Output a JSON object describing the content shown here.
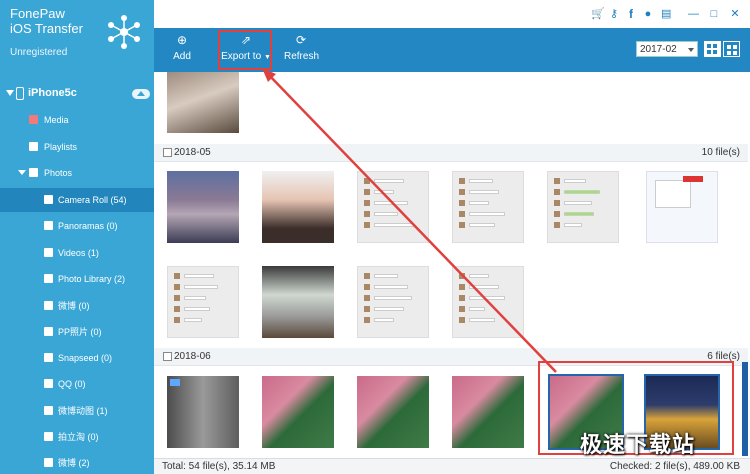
{
  "app": {
    "name_line1": "FonePaw",
    "name_line2": "iOS Transfer",
    "registration": "Unregistered"
  },
  "device": {
    "name": "iPhone5c"
  },
  "sidebar": {
    "items": [
      {
        "label": "Media",
        "icon": "music-icon"
      },
      {
        "label": "Playlists",
        "icon": "playlist-icon"
      },
      {
        "label": "Photos",
        "icon": "photos-icon"
      },
      {
        "label": "Camera Roll (54)",
        "icon": "camera-icon"
      },
      {
        "label": "Panoramas (0)",
        "icon": "camera-icon"
      },
      {
        "label": "Videos (1)",
        "icon": "camera-icon"
      },
      {
        "label": "Photo Library (2)",
        "icon": "album-icon"
      },
      {
        "label": "微博 (0)",
        "icon": "album-icon"
      },
      {
        "label": "PP照片 (0)",
        "icon": "album-icon"
      },
      {
        "label": "Snapseed (0)",
        "icon": "album-icon"
      },
      {
        "label": "QQ (0)",
        "icon": "album-icon"
      },
      {
        "label": "微博动图 (1)",
        "icon": "album-icon"
      },
      {
        "label": "拍立淘 (0)",
        "icon": "album-icon"
      },
      {
        "label": "微博 (2)",
        "icon": "album-icon"
      }
    ]
  },
  "toolbar": {
    "add_label": "Add",
    "export_label": "Export to",
    "refresh_label": "Refresh",
    "date_filter": "2017-02"
  },
  "sections": [
    {
      "date": "2018-05",
      "count": "10 file(s)"
    },
    {
      "date": "2018-06",
      "count": "6 file(s)"
    }
  ],
  "status": {
    "total": "Total: 54 file(s), 35.14 MB",
    "checked": "Checked: 2 file(s), 489.00 KB"
  },
  "watermark": "极速下载站",
  "colors": {
    "sidebar": "#3aa6d6",
    "toolbar": "#2287c2",
    "highlight": "#e0413e"
  }
}
